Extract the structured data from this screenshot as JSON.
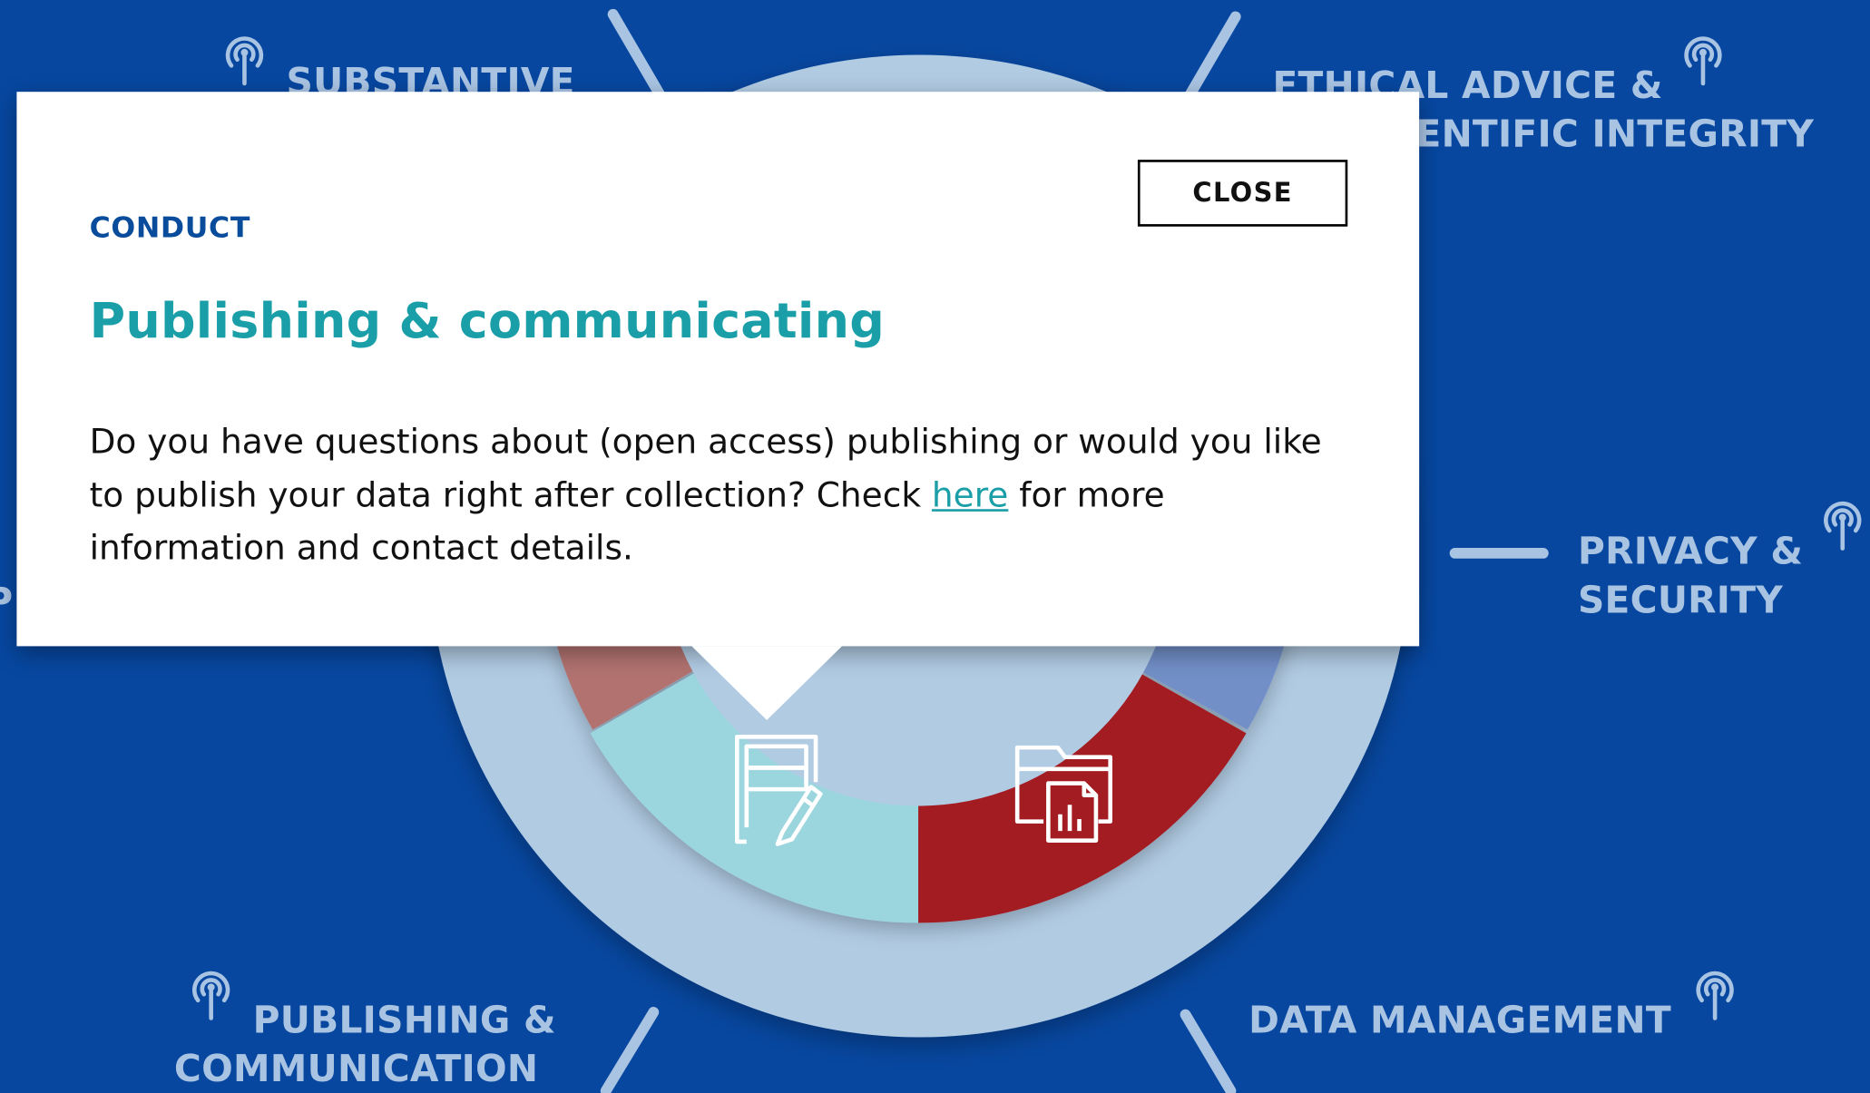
{
  "diagram": {
    "labels": {
      "substantive": "SUBSTANTIVE",
      "ethical_line1": "ETHICAL ADVICE &",
      "ethical_line2": "SCIENTIFIC INTEGRITY",
      "privacy_line1": "PRIVACY &",
      "privacy_line2": "SECURITY",
      "publishing_line1": "PUBLISHING &",
      "publishing_line2": "COMMUNICATION",
      "data_management": "DATA MANAGEMENT",
      "left_partial": "P"
    },
    "segments": [
      {
        "name": "publishing-segment",
        "color": "#9bd6de",
        "icon": "document-edit-icon"
      },
      {
        "name": "data-segment",
        "color": "#a31c22",
        "icon": "folder-chart-icon"
      },
      {
        "name": "left-segment",
        "color": "#b2736f"
      },
      {
        "name": "right-segment",
        "color": "#728fc8"
      }
    ],
    "colors": {
      "background": "#0747a0",
      "outer_ring": "#b1cbe3",
      "label": "#a9c4e3"
    }
  },
  "modal": {
    "category": "CONDUCT",
    "title": "Publishing & communicating",
    "body_before_link": "Do you have questions about (open access) publishing or would you like to publish your data right after collection? Check ",
    "link_text": "here",
    "body_after_link": " for more information and contact details.",
    "close_label": "CLOSE"
  }
}
